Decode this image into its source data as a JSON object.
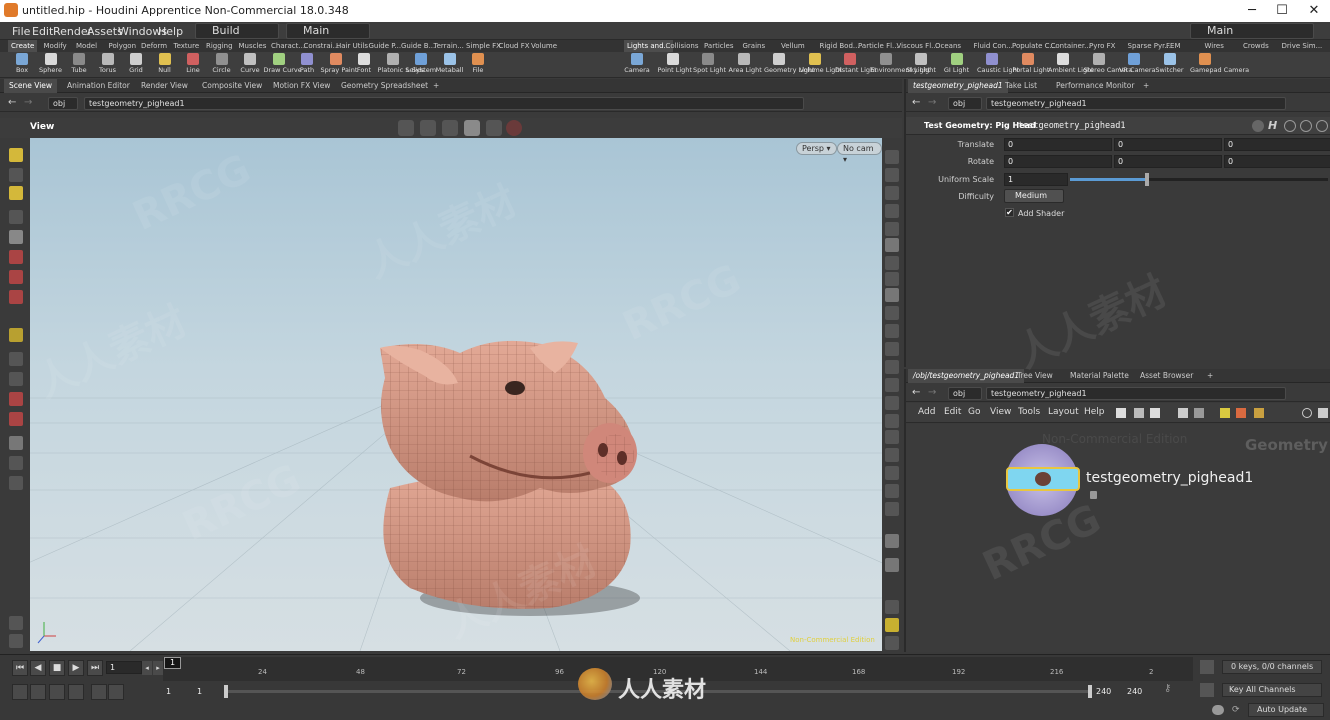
{
  "window": {
    "title": "untitled.hip - Houdini Apprentice Non-Commercial 18.0.348",
    "minimize": "─",
    "maximize": "☐",
    "close": "✕"
  },
  "menubar": {
    "items": [
      "File",
      "Edit",
      "Render",
      "Assets",
      "Windows",
      "Help"
    ],
    "build_label": "Build",
    "main_label": "Main",
    "desktop_label": "Main"
  },
  "shelf_left": {
    "tabs": [
      "Create",
      "Modify",
      "Model",
      "Polygon",
      "Deform",
      "Texture",
      "Rigging",
      "Muscles",
      "Charact...",
      "Constrai...",
      "Hair Utils",
      "Guide P...",
      "Guide B...",
      "Terrain...",
      "Simple FX",
      "Cloud FX",
      "Volume"
    ],
    "tools": [
      "Box",
      "Sphere",
      "Tube",
      "Torus",
      "Grid",
      "Null",
      "Line",
      "Circle",
      "Curve",
      "Draw Curve",
      "Path",
      "Spray Paint",
      "Font",
      "Platonic Solids",
      "L-System",
      "Metaball",
      "File"
    ]
  },
  "shelf_right": {
    "tabs": [
      "Lights and...",
      "Collisions",
      "Particles",
      "Grains",
      "Vellum",
      "Rigid Bod...",
      "Particle Fl...",
      "Viscous Fl...",
      "Oceans",
      "Fluid Con...",
      "Populate C...",
      "Container...",
      "Pyro FX",
      "Sparse Pyr...",
      "FEM",
      "Wires",
      "Crowds",
      "Drive Sim..."
    ],
    "tools": [
      "Camera",
      "Point Light",
      "Spot Light",
      "Area Light",
      "Geometry Light",
      "Volume Light",
      "Distant Light",
      "Environment Light",
      "Sky Light",
      "GI Light",
      "Caustic Light",
      "Portal Light",
      "Ambient Light",
      "Stereo Camera",
      "VR Camera",
      "Switcher",
      "Gamepad Camera"
    ]
  },
  "left_pane": {
    "tabs": [
      "Scene View",
      "Animation Editor",
      "Render View",
      "Composite View",
      "Motion FX View",
      "Geometry Spreadsheet"
    ],
    "path_root": "obj",
    "path_node": "testgeometry_pighead1",
    "view_label": "View",
    "persp_label": "Persp",
    "cam_label": "No cam",
    "nc_edition": "Non-Commercial Edition"
  },
  "params_pane": {
    "tabs": [
      "testgeometry_pighead1",
      "Take List",
      "Performance Monitor"
    ],
    "path_root": "obj",
    "path_node": "testgeometry_pighead1",
    "node_type": "Test Geometry: Pig Head",
    "node_name": "testgeometry_pighead1",
    "translate_label": "Translate",
    "translate": [
      "0",
      "0",
      "0"
    ],
    "rotate_label": "Rotate",
    "rotate": [
      "0",
      "0",
      "0"
    ],
    "scale_label": "Uniform Scale",
    "scale_value": "1",
    "scale_slider": 0.3,
    "difficulty_label": "Difficulty",
    "difficulty_value": "Medium",
    "add_shader_label": "Add Shader",
    "add_shader_checked": true
  },
  "network_pane": {
    "tabs": [
      "/obj/testgeometry_pighead1",
      "Tree View",
      "Material Palette",
      "Asset Browser"
    ],
    "path_root": "obj",
    "path_node": "testgeometry_pighead1",
    "menu": [
      "Add",
      "Edit",
      "Go",
      "View",
      "Tools",
      "Layout",
      "Help"
    ],
    "watermark": "Non-Commercial Edition",
    "context_label": "Geometry",
    "node_label": "testgeometry_pighead1"
  },
  "timeline": {
    "current_frame": "1",
    "ticks": [
      "1",
      "24",
      "48",
      "72",
      "96",
      "120",
      "144",
      "168",
      "192",
      "216",
      "2"
    ],
    "start_a": "1",
    "start_b": "1",
    "end_a": "240",
    "end_b": "240",
    "keys_info": "0 keys, 0/0 channels",
    "key_all": "Key All Channels",
    "auto_update": "Auto Update"
  },
  "overlay": {
    "watermark_en": "RRCG",
    "watermark_cn": "人人素材",
    "logo_text": "人人素材"
  },
  "colors": {
    "accent_blue": "#5b9bd5",
    "shelf_bg": "#3e3e3e",
    "pane_bg": "#3a3a3a",
    "viewport_sky": "#a9c5d5",
    "pig_skin": "#d79a86",
    "node_cyan": "#7fd6f0"
  }
}
